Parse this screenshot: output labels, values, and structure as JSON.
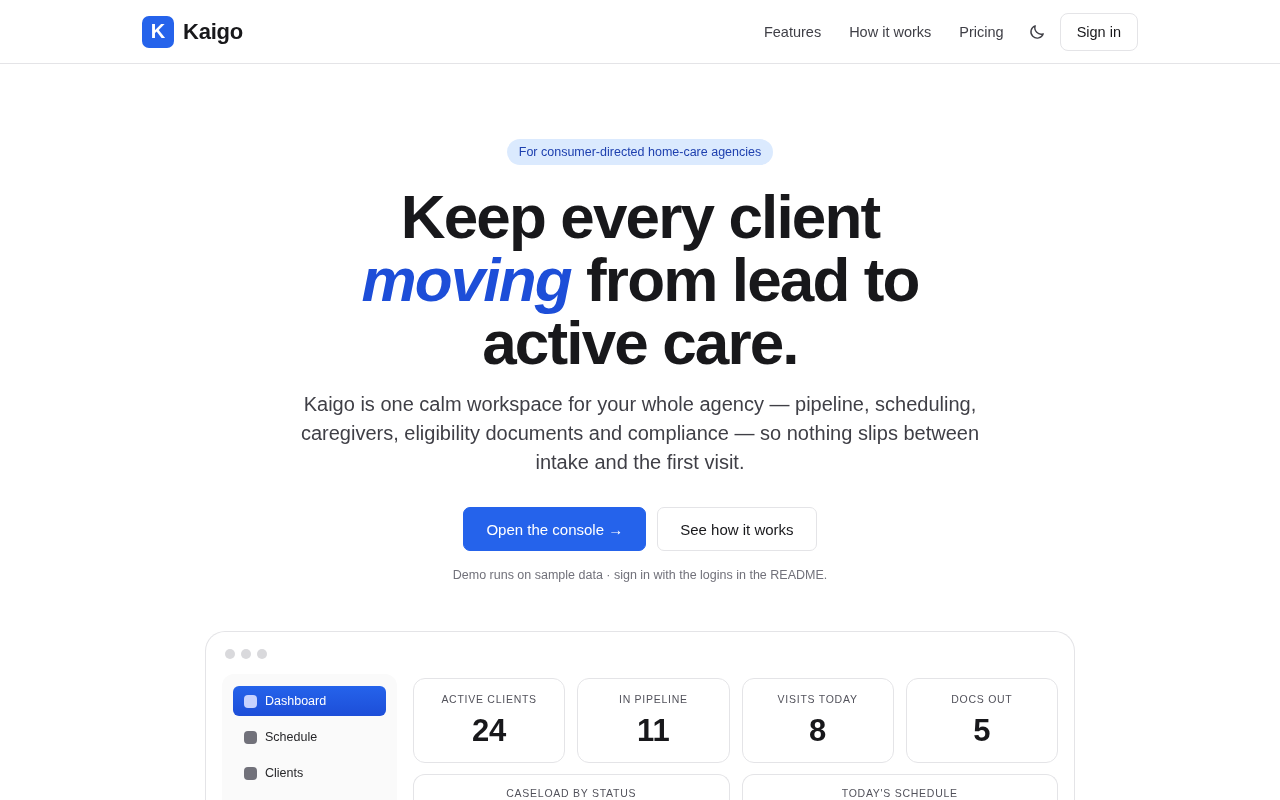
{
  "header": {
    "logo_mark": "K",
    "brand": "Kaigo",
    "nav": [
      {
        "label": "Features"
      },
      {
        "label": "How it works"
      },
      {
        "label": "Pricing"
      }
    ],
    "sign_in": "Sign in"
  },
  "hero": {
    "badge": "For consumer-directed home-care agencies",
    "headline": "Keep every client *moving* from lead to active care.",
    "subtitle": "Kaigo is one calm workspace for your whole agency — pipeline, scheduling, caregivers, eligibility documents and compliance — so nothing slips between intake and the first visit.",
    "actions": [
      {
        "label": "Open the console →",
        "kind": "primary"
      },
      {
        "label": "See how it works",
        "kind": "secondary"
      }
    ],
    "note": "Demo runs on sample data · sign in with the logins in the README."
  },
  "preview": {
    "sidebar": [
      {
        "label": "Dashboard",
        "selected": true
      },
      {
        "label": "Schedule",
        "selected": false
      },
      {
        "label": "Clients",
        "selected": false
      }
    ],
    "stats": [
      {
        "label": "ACTIVE CLIENTS",
        "value": "24"
      },
      {
        "label": "IN PIPELINE",
        "value": "11"
      },
      {
        "label": "VISITS TODAY",
        "value": "8"
      },
      {
        "label": "DOCS OUT",
        "value": "5"
      }
    ],
    "panels": [
      {
        "title": "CASELOAD BY STATUS"
      },
      {
        "title": "TODAY'S SCHEDULE"
      }
    ]
  }
}
